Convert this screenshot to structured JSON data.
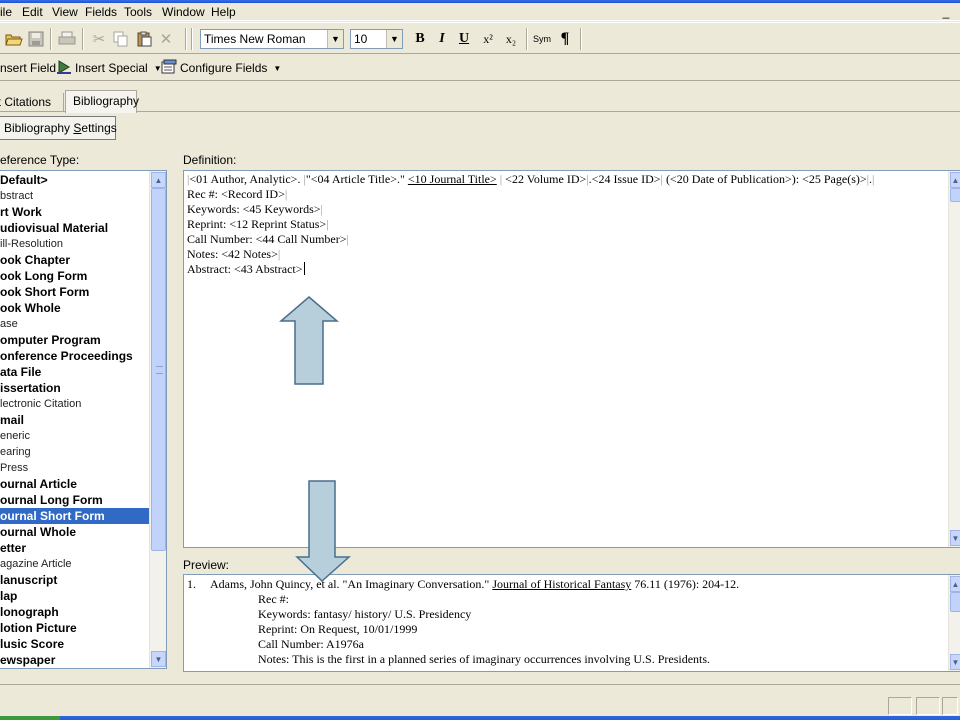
{
  "menubar": {
    "items": [
      "ile",
      "Edit",
      "View",
      "Fields",
      "Tools",
      "Window",
      "Help"
    ],
    "minimize": "_"
  },
  "toolbar": {
    "font_name": "Times New Roman",
    "font_size": "10",
    "bold": "B",
    "italic": "I",
    "underline": "U",
    "superscript": "x²",
    "subscript": "x₂",
    "symbol": "Sym",
    "paragraph": "¶"
  },
  "toolbar2": {
    "insert_field": "nsert Field",
    "insert_special": "Insert Special",
    "configure_fields": "Configure Fields"
  },
  "tabs": [
    {
      "label": "Text Citations",
      "active": false
    },
    {
      "label": "Bibliography",
      "active": true
    }
  ],
  "bibliography_settings_button": {
    "prefix": "Bibliography ",
    "underlined": "S",
    "rest": "ettings"
  },
  "reference_type_label": "eference Type:",
  "reference_types": [
    {
      "label": "Default>",
      "bold": true,
      "selected": false
    },
    {
      "label": "bstract",
      "bold": false,
      "selected": false
    },
    {
      "label": "rt Work",
      "bold": true,
      "selected": false
    },
    {
      "label": "udiovisual Material",
      "bold": true,
      "selected": false
    },
    {
      "label": "ill-Resolution",
      "bold": false,
      "selected": false
    },
    {
      "label": "ook Chapter",
      "bold": true,
      "selected": false
    },
    {
      "label": "ook Long Form",
      "bold": true,
      "selected": false
    },
    {
      "label": "ook Short Form",
      "bold": true,
      "selected": false
    },
    {
      "label": "ook Whole",
      "bold": true,
      "selected": false
    },
    {
      "label": "ase",
      "bold": false,
      "selected": false
    },
    {
      "label": "omputer Program",
      "bold": true,
      "selected": false
    },
    {
      "label": "onference Proceedings",
      "bold": true,
      "selected": false
    },
    {
      "label": "ata File",
      "bold": true,
      "selected": false
    },
    {
      "label": "issertation",
      "bold": true,
      "selected": false
    },
    {
      "label": "lectronic Citation",
      "bold": false,
      "selected": false
    },
    {
      "label": "mail",
      "bold": true,
      "selected": false
    },
    {
      "label": "eneric",
      "bold": false,
      "selected": false
    },
    {
      "label": "earing",
      "bold": false,
      "selected": false
    },
    {
      "label": " Press",
      "bold": false,
      "selected": false
    },
    {
      "label": "ournal Article",
      "bold": true,
      "selected": false
    },
    {
      "label": "ournal Long Form",
      "bold": true,
      "selected": false
    },
    {
      "label": "ournal Short Form",
      "bold": true,
      "selected": true
    },
    {
      "label": "ournal Whole",
      "bold": true,
      "selected": false
    },
    {
      "label": "etter",
      "bold": true,
      "selected": false
    },
    {
      "label": "agazine Article",
      "bold": false,
      "selected": false
    },
    {
      "label": "lanuscript",
      "bold": true,
      "selected": false
    },
    {
      "label": "lap",
      "bold": true,
      "selected": false
    },
    {
      "label": "lonograph",
      "bold": true,
      "selected": false
    },
    {
      "label": "lotion Picture",
      "bold": true,
      "selected": false
    },
    {
      "label": "lusic Score",
      "bold": true,
      "selected": false
    },
    {
      "label": "ewspaper",
      "bold": true,
      "selected": false
    }
  ],
  "definition": {
    "label": "Definition:",
    "line1": {
      "a": "<01 Author, Analytic>",
      "b": ". ",
      "c": "\"<04 Article Title>.\" ",
      "d": "<10 Journal Title>",
      "e": " <22 Volume ID>",
      "f": ".<24 Issue ID>",
      "g": " (<20 Date of Publication>): <25 Page(s)>",
      "h": "."
    },
    "lines": [
      "Rec #: <Record ID>",
      "Keywords: <45 Keywords>",
      "Reprint: <12 Reprint Status>",
      "Call Number: <44 Call Number>",
      "Notes: <42 Notes>",
      "Abstract: <43 Abstract>"
    ]
  },
  "preview": {
    "label": "Preview:",
    "number": "1.",
    "first_a": "Adams, John Quincy, et al. \"An Imaginary Conversation.\" ",
    "first_journal": "Journal of Historical Fantasy",
    "first_b": " 76.11 (1976): 204-12.",
    "lines": [
      "Rec #:",
      "Keywords: fantasy/ history/ U.S. Presidency",
      "Reprint: On Request, 10/01/1999",
      "Call Number: A1976a",
      "Notes: This is the first in a planned series of imaginary occurrences involving U.S. Presidents."
    ]
  },
  "colors": {
    "selection": "#316ac5",
    "arrow_fill": "#b7cfdb",
    "arrow_stroke": "#4a6f8c"
  }
}
